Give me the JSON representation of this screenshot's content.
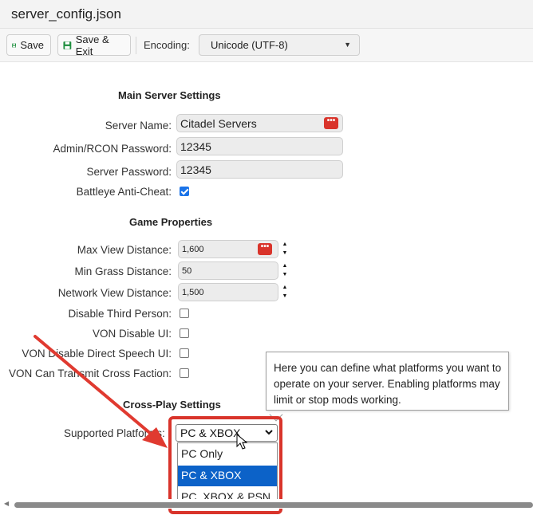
{
  "window": {
    "title": "server_config.json"
  },
  "toolbar": {
    "save_label": "Save",
    "save_exit_label": "Save & Exit",
    "encoding_label": "Encoding:",
    "encoding_value": "Unicode (UTF-8)"
  },
  "main_settings": {
    "heading": "Main Server Settings",
    "server_name_label": "Server Name:",
    "server_name_value": "Citadel Servers",
    "admin_password_label": "Admin/RCON Password:",
    "admin_password_value": "12345",
    "server_password_label": "Server Password:",
    "server_password_value": "12345",
    "battleye_label": "Battleye Anti-Cheat:",
    "battleye_checked": true
  },
  "game_properties": {
    "heading": "Game Properties",
    "max_view_label": "Max View Distance:",
    "max_view_value": "1,600",
    "min_grass_label": "Min Grass Distance:",
    "min_grass_value": "50",
    "network_view_label": "Network View Distance:",
    "network_view_value": "1,500",
    "disable_third_person_label": "Disable Third Person:",
    "von_disable_ui_label": "VON Disable UI:",
    "von_disable_speech_label": "VON Disable Direct Speech UI:",
    "von_cross_faction_label": "VON Can Transmit Cross Faction:"
  },
  "crossplay": {
    "heading": "Cross-Play Settings",
    "platforms_label": "Supported Platforms:",
    "selected": "PC & XBOX",
    "options": [
      "PC Only",
      "PC & XBOX",
      "PC, XBOX & PSN"
    ],
    "tooltip": "Here you can define what platforms you want to operate on your server. Enabling platforms may limit or stop mods working."
  },
  "colors": {
    "highlight": "#d9342b",
    "selected_option": "#0c62c8",
    "checkbox": "#1a73e8"
  },
  "icons": [
    "save-icon",
    "dots-icon",
    "chevron-down-icon",
    "mouse-cursor-icon",
    "annotation-arrow"
  ]
}
